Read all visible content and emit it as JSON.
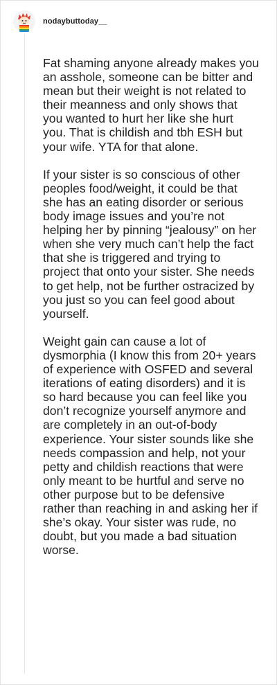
{
  "post": {
    "username": "nodaybuttoday__",
    "paragraphs": [
      "Fat shaming anyone already makes you an asshole, someone can be bitter and mean but their weight is not related to their meanness and only shows that you wanted to hurt her like she hurt you. That is childish and tbh ESH but your wife. YTA for that alone.",
      "If your sister is so conscious of other peoples food/weight, it could be that she has an eating disorder or serious body image issues and you’re not helping her by pinning “jealousy” on her when she very much can’t help the fact that she is triggered and trying to project that onto your sister. She needs to get help, not be further ostracized by you just so you can feel good about yourself.",
      "Weight gain can cause a lot of dysmorphia (I know this from 20+ years of experience with OSFED and several iterations of eating disorders) and it is so hard because you can feel like you don’t recognize yourself anymore and are completely in an out-of-body experience. Your sister sounds like she needs compassion and help, not your petty and childish reactions that were only meant to be hurtful and serve no other purpose but to be defensive rather than reaching in and asking her if she’s okay. Your sister was rude, no doubt, but you made a bad situation worse."
    ]
  }
}
